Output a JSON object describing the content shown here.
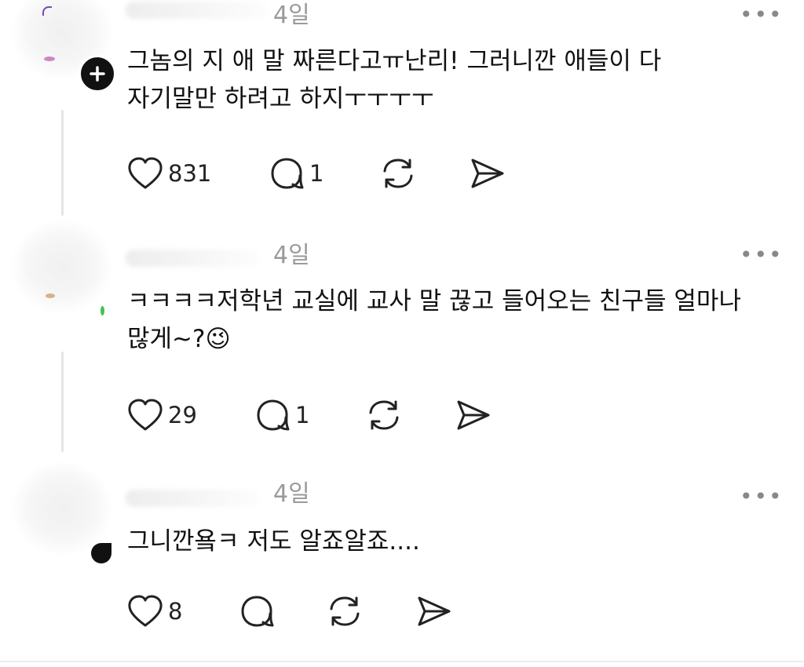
{
  "comments": [
    {
      "time": "4일",
      "more": "•••",
      "text": "그놈의 지 애 말 짜른다고ㅠ난리! 그러니깐 애들이 다\n자기말만 하려고 하지ㅜㅜㅜㅜ",
      "likes": "831",
      "replies": "1"
    },
    {
      "time": "4일",
      "more": "•••",
      "text": "ㅋㅋㅋㅋ저학년 교실에 교사 말 끊고 들어오는 친구들 얼마나\n많게~?😉",
      "likes": "29",
      "replies": "1"
    },
    {
      "time": "4일",
      "more": "•••",
      "text": "그니깐욬ㅋ 저도 알죠알죠....",
      "likes": "8",
      "replies": ""
    }
  ],
  "icons": {
    "like": "heart-icon",
    "reply": "speech-bubble-icon",
    "repost": "repost-icon",
    "share": "send-icon",
    "follow": "plus-icon"
  },
  "colors": {
    "text": "#111111",
    "muted": "#9a9a9a",
    "line": "#e5e5e5"
  }
}
